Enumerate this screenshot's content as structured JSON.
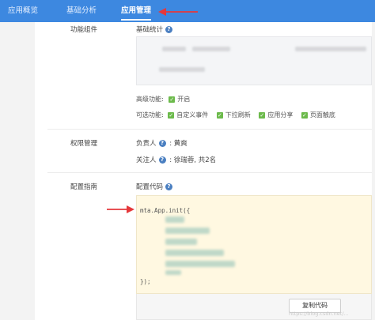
{
  "nav": {
    "tabs": [
      {
        "label": "应用概览",
        "active": false
      },
      {
        "label": "基础分析",
        "active": false
      },
      {
        "label": "应用管理",
        "active": true
      }
    ]
  },
  "sections": {
    "features": {
      "title": "功能组件",
      "basic_stats_label": "基础统计",
      "advanced_label": "高级功能:",
      "advanced_options": [
        "开启"
      ],
      "optional_label": "可选功能:",
      "optional_options": [
        "自定义事件",
        "下拉刷新",
        "应用分享",
        "页面触底"
      ]
    },
    "permissions": {
      "title": "权限管理",
      "owner_label": "负责人",
      "owner_value": ": 黄爽",
      "followers_label": "关注人",
      "followers_value": ": 徐瑞蓉, 共2名"
    },
    "config": {
      "title": "配置指南",
      "code_label": "配置代码",
      "code_first_line": "mta.App.init({",
      "code_last_line": "});",
      "copy_button": "复制代码"
    }
  },
  "watermark": "https://blog.csdn.net/...",
  "colors": {
    "nav_bg": "#3d88e0",
    "arrow": "#e5383b",
    "checkbox": "#6cba4b",
    "code_bg": "#fff8e1",
    "help_icon": "#4a7fc1"
  }
}
